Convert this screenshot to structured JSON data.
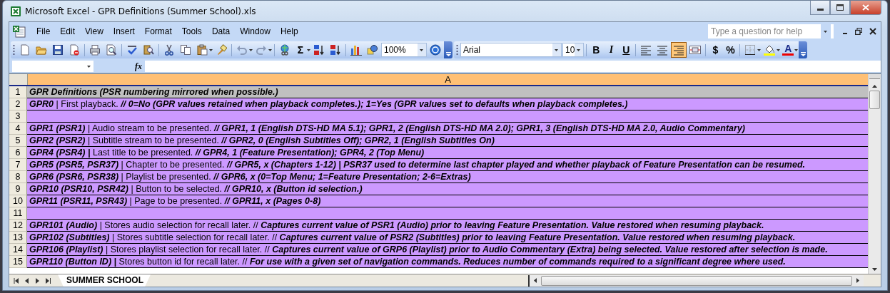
{
  "window": {
    "title": "Microsoft Excel - GPR Definitions (Summer School).xls"
  },
  "menu": [
    {
      "label": "File"
    },
    {
      "label": "Edit"
    },
    {
      "label": "View"
    },
    {
      "label": "Insert"
    },
    {
      "label": "Format"
    },
    {
      "label": "Tools"
    },
    {
      "label": "Data"
    },
    {
      "label": "Window"
    },
    {
      "label": "Help"
    }
  ],
  "help_box": {
    "placeholder": "Type a question for help"
  },
  "toolbars": [
    {
      "items": [
        {
          "kind": "new"
        },
        {
          "kind": "open"
        },
        {
          "kind": "save"
        },
        {
          "kind": "permission"
        },
        {
          "kind": "separator"
        },
        {
          "kind": "print"
        },
        {
          "kind": "preview"
        },
        {
          "kind": "separator"
        },
        {
          "kind": "spelling"
        },
        {
          "kind": "research"
        },
        {
          "kind": "separator"
        },
        {
          "kind": "cut"
        },
        {
          "kind": "copy"
        },
        {
          "kind": "paste",
          "dropdown": true
        },
        {
          "kind": "painter"
        },
        {
          "kind": "separator"
        },
        {
          "kind": "undo",
          "dropdown": true
        },
        {
          "kind": "redo",
          "dropdown": true
        },
        {
          "kind": "separator"
        },
        {
          "kind": "hyperlink"
        },
        {
          "kind": "sum",
          "label": "Σ",
          "dropdown": true
        },
        {
          "kind": "sort-asc"
        },
        {
          "kind": "sort-desc"
        },
        {
          "kind": "separator"
        },
        {
          "kind": "chart"
        },
        {
          "kind": "drawing"
        },
        {
          "kind": "zoom",
          "value": "100%"
        },
        {
          "kind": "help"
        },
        {
          "kind": "options"
        }
      ]
    },
    {
      "items": [
        {
          "kind": "font",
          "value": "Arial"
        },
        {
          "kind": "fontsize",
          "value": "10"
        },
        {
          "kind": "separator"
        },
        {
          "kind": "bold",
          "label": "B"
        },
        {
          "kind": "italic",
          "label": "I"
        },
        {
          "kind": "underline",
          "label": "U"
        },
        {
          "kind": "separator"
        },
        {
          "kind": "align-left",
          "selected": false
        },
        {
          "kind": "align-center",
          "selected": false
        },
        {
          "kind": "align-right",
          "selected": true
        },
        {
          "kind": "merge"
        },
        {
          "kind": "separator"
        },
        {
          "kind": "currency",
          "label": "$"
        },
        {
          "kind": "percent",
          "label": "%"
        },
        {
          "kind": "separator"
        },
        {
          "kind": "borders",
          "dropdown": true
        },
        {
          "kind": "fill-color",
          "dropdown": true
        },
        {
          "kind": "fontcolor",
          "label": "A",
          "dropdown": true
        },
        {
          "kind": "options"
        }
      ]
    }
  ],
  "formula_bar": {
    "function_label": "fx"
  },
  "sheet": {
    "columns": [
      {
        "label": "A"
      }
    ],
    "rows": [
      {
        "number": "1",
        "color": "#c0c0c0",
        "segments": [
          {
            "text": "GPR Definitions (PSR numbering mirrored when possible.)",
            "kind": "emphasis"
          }
        ]
      },
      {
        "number": "2",
        "color": "#cc99ff",
        "segments": [
          {
            "text": "GPR0",
            "kind": "emphasis"
          },
          {
            "text": " | First playback. ",
            "kind": "plain"
          },
          {
            "text": "// 0=No (GPR values retained when playback completes.); 1=Yes (GPR values set to defaults when playback completes.)",
            "kind": "emphasis"
          }
        ]
      },
      {
        "number": "3",
        "color": "#cc99ff"
      },
      {
        "number": "4",
        "color": "#cc99ff",
        "segments": [
          {
            "text": "GPR1 (PSR1)",
            "kind": "emphasis"
          },
          {
            "text": " | Audio stream to be presented. ",
            "kind": "plain"
          },
          {
            "text": "// GPR1, 1 (English DTS-HD MA 5.1); GPR1, 2 (English DTS-HD MA 2.0); GPR1, 3 (English DTS-HD MA 2.0, Audio Commentary)",
            "kind": "emphasis"
          }
        ]
      },
      {
        "number": "5",
        "color": "#cc99ff",
        "segments": [
          {
            "text": "GPR2 (PSR2)",
            "kind": "emphasis"
          },
          {
            "text": " | Subtitle stream to be presented. ",
            "kind": "plain"
          },
          {
            "text": "// GPR2, 0 (English Subtitles Off); GPR2, 1 (English Subtitles On)",
            "kind": "emphasis"
          }
        ]
      },
      {
        "number": "6",
        "color": "#cc99ff",
        "segments": [
          {
            "text": "GPR4 (PSR4) |",
            "kind": "emphasis"
          },
          {
            "text": " Last title to be presented. ",
            "kind": "plain"
          },
          {
            "text": "// GPR4, 1 (Feature Presentation); GPR4, 2 (Top Menu)",
            "kind": "emphasis"
          }
        ]
      },
      {
        "number": "7",
        "color": "#cc99ff",
        "segments": [
          {
            "text": "GPR5 (PSR5, PSR37)",
            "kind": "emphasis"
          },
          {
            "text": " | Chapter to be presented. ",
            "kind": "plain"
          },
          {
            "text": "// GPR5, x (Chapters 1-12) | PSR37 used to determine last chapter played and whether playback of Feature Presentation can be resumed.",
            "kind": "emphasis"
          }
        ]
      },
      {
        "number": "8",
        "color": "#cc99ff",
        "segments": [
          {
            "text": "GPR6 (PSR6, PSR38)",
            "kind": "emphasis"
          },
          {
            "text": " | Playlist be presented. ",
            "kind": "plain"
          },
          {
            "text": "// GPR6, x (0=Top Menu; 1=Feature Presentation; 2-6=Extras)",
            "kind": "emphasis"
          }
        ]
      },
      {
        "number": "9",
        "color": "#cc99ff",
        "segments": [
          {
            "text": "GPR10 (PSR10, PSR42)",
            "kind": "emphasis"
          },
          {
            "text": " | Button to be selected. ",
            "kind": "plain"
          },
          {
            "text": "// GPR10, x (Button id selection.)",
            "kind": "emphasis"
          }
        ]
      },
      {
        "number": "10",
        "color": "#cc99ff",
        "segments": [
          {
            "text": "GPR11 (PSR11, PSR43)",
            "kind": "emphasis"
          },
          {
            "text": " | Page to be presented. ",
            "kind": "plain"
          },
          {
            "text": "// GPR11, x (Pages 0-8)",
            "kind": "emphasis"
          }
        ]
      },
      {
        "number": "11",
        "color": "#cc99ff"
      },
      {
        "number": "12",
        "color": "#cc99ff",
        "segments": [
          {
            "text": "GPR101 (Audio)",
            "kind": "emphasis"
          },
          {
            "text": " | Stores audio selection for recall later. // ",
            "kind": "plain"
          },
          {
            "text": "Captures current value of PSR1 (Audio) prior to leaving Feature Presentation. Value restored when resuming playback.",
            "kind": "emphasis"
          }
        ]
      },
      {
        "number": "13",
        "color": "#cc99ff",
        "segments": [
          {
            "text": "GPR102 (Subtitles)",
            "kind": "emphasis"
          },
          {
            "text": " | Stores subtitle selection for recall later. // ",
            "kind": "plain"
          },
          {
            "text": "Captures current value of PSR2 (Subtitles) prior to leaving Feature Presentation. Value restored when resuming playback.",
            "kind": "emphasis"
          }
        ]
      },
      {
        "number": "14",
        "color": "#cc99ff",
        "segments": [
          {
            "text": "GPR106 (Playlist)",
            "kind": "emphasis"
          },
          {
            "text": " | Stores playlist selection for recall later. // ",
            "kind": "plain"
          },
          {
            "text": "Captures current value of GRP6 (Playlist) prior to Audio Commentary (Extra) being selected. Value restored after selection is made.",
            "kind": "emphasis"
          }
        ]
      },
      {
        "number": "15",
        "color": "#cc99ff",
        "segments": [
          {
            "text": "GPR110 (Button ID) |",
            "kind": "emphasis"
          },
          {
            "text": " Stores button id for recall later. // ",
            "kind": "plain"
          },
          {
            "text": "For use with a given set of navigation commands. Reduces number of commands required to a significant degree where used.",
            "kind": "emphasis"
          }
        ]
      }
    ]
  },
  "sheet_tabs": [
    {
      "label": "SUMMER SCHOOL",
      "selected": true
    }
  ]
}
